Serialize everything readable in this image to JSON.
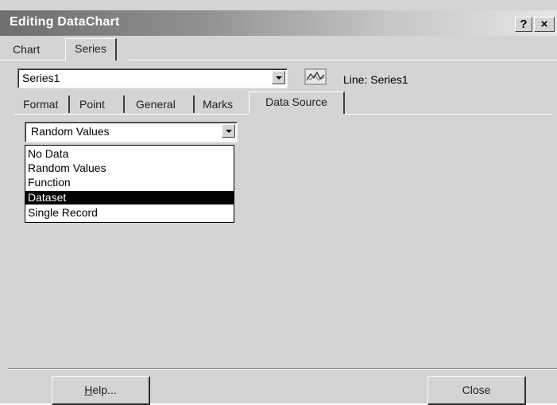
{
  "window": {
    "title": "Editing DataChart",
    "help_button": "?",
    "close_button": "×"
  },
  "main_tabs": [
    {
      "label": "Chart",
      "active": false
    },
    {
      "label": "Series",
      "active": true
    }
  ],
  "series_selector": {
    "value": "Series1",
    "type_icon": "line-chart-icon",
    "type_label": "Line: Series1"
  },
  "sub_tabs": [
    {
      "label": "Format",
      "active": false
    },
    {
      "label": "Point",
      "active": false
    },
    {
      "label": "General",
      "active": false
    },
    {
      "label": "Marks",
      "active": false
    },
    {
      "label": "Data Source",
      "active": true
    }
  ],
  "data_source": {
    "selected": "Random Values",
    "options": [
      "No Data",
      "Random Values",
      "Function",
      "Dataset",
      "Single Record"
    ],
    "highlighted": "Dataset"
  },
  "buttons": {
    "help_prefix": "",
    "help_underlined": "H",
    "help_rest": "elp...",
    "close": "Close"
  }
}
